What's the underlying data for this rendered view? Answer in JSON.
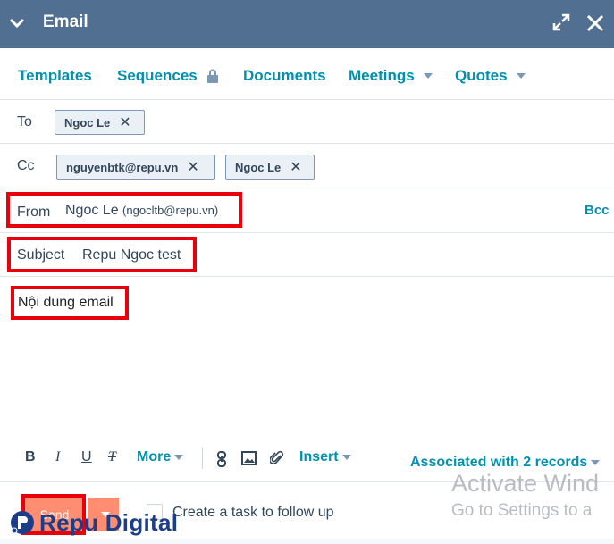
{
  "header": {
    "title": "Email"
  },
  "tabs": [
    {
      "label": "Templates"
    },
    {
      "label": "Sequences"
    },
    {
      "label": "Documents"
    },
    {
      "label": "Meetings"
    },
    {
      "label": "Quotes"
    }
  ],
  "to": {
    "label": "To",
    "recipients": [
      "Ngoc Le"
    ]
  },
  "cc": {
    "label": "Cc",
    "recipients": [
      "nguyenbtk@repu.vn",
      "Ngoc Le"
    ]
  },
  "from": {
    "label": "From",
    "name": "Ngoc Le",
    "email": "(ngocltb@repu.vn)",
    "bcc_label": "Bcc"
  },
  "subject": {
    "label": "Subject",
    "value": "Repu Ngoc test"
  },
  "body": {
    "text": "Nội dung email"
  },
  "toolbar": {
    "bold": "B",
    "italic": "I",
    "underline": "U",
    "clear_format": "T",
    "more_label": "More",
    "insert_label": "Insert",
    "associated_label": "Associated with 2 records"
  },
  "footer": {
    "send_label": "Send",
    "task_label": "Create a task to follow up"
  },
  "watermark": {
    "logo_text": "Repu Digital",
    "line1": "Activate Wind",
    "line2": "Go to Settings to a"
  },
  "colors": {
    "header_bg": "#516f90",
    "link": "#0091ae",
    "accent": "#ff7a59",
    "highlight": "#e8000b"
  }
}
